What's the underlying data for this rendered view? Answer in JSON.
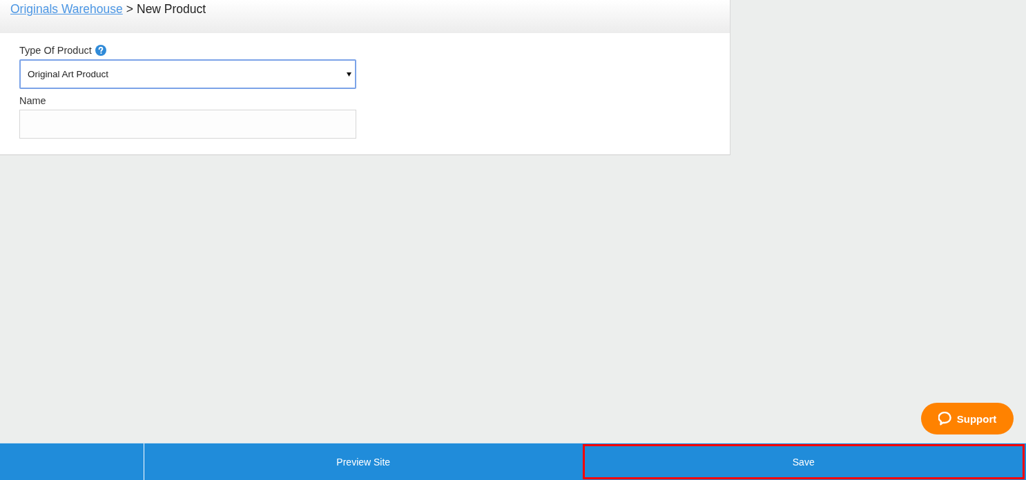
{
  "breadcrumb": {
    "link": "Originals Warehouse",
    "separator": ">",
    "current": "New Product"
  },
  "form": {
    "fields": [
      {
        "kind": "select",
        "label": "Type Of Product",
        "help": true,
        "value": "Original Art Product",
        "focused": true
      },
      {
        "kind": "text",
        "label": "Name",
        "help": false,
        "focused": false
      }
    ]
  },
  "support_button": {
    "label": "Support"
  },
  "footer": {
    "buttons": [
      {
        "label": "Preview Site",
        "highlighted": false
      },
      {
        "label": "Save",
        "highlighted": true
      }
    ]
  }
}
